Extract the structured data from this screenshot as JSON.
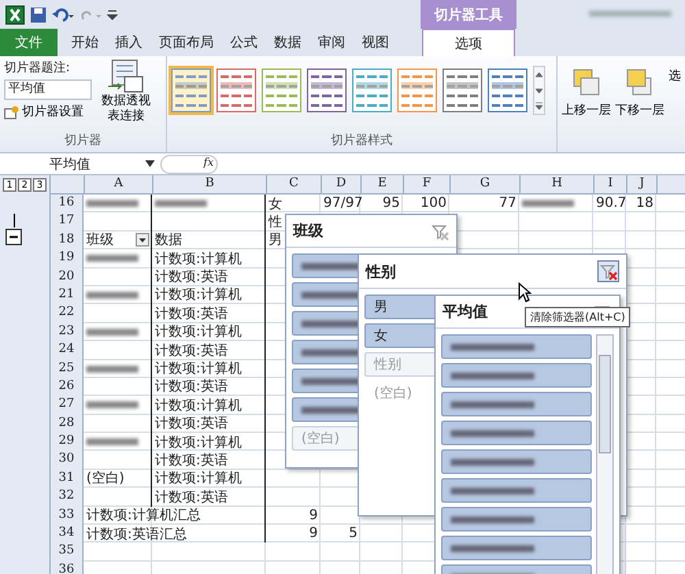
{
  "contextual_tab": {
    "title": "切片器工具"
  },
  "tabs": [
    {
      "label": "文件",
      "kind": "file",
      "selected": false
    },
    {
      "label": "开始",
      "kind": "tab",
      "selected": false
    },
    {
      "label": "插入",
      "kind": "tab",
      "selected": false
    },
    {
      "label": "页面布局",
      "kind": "tab",
      "selected": false
    },
    {
      "label": "公式",
      "kind": "tab",
      "selected": false
    },
    {
      "label": "数据",
      "kind": "tab",
      "selected": false
    },
    {
      "label": "审阅",
      "kind": "tab",
      "selected": false
    },
    {
      "label": "视图",
      "kind": "tab",
      "selected": false
    },
    {
      "label": "选项",
      "kind": "contextual",
      "selected": true
    }
  ],
  "ribbon": {
    "caption_label": "切片器题注:",
    "caption_value": "平均值",
    "settings_button": "切片器设置",
    "connections_button": "数据透视表连接",
    "group_1": "切片器",
    "group_2": "切片器样式",
    "styles": [
      {
        "color": "#7f9cc8",
        "selected": true
      },
      {
        "color": "#d86a6a",
        "selected": false
      },
      {
        "color": "#9bbb59",
        "selected": false
      },
      {
        "color": "#8064a2",
        "selected": false
      },
      {
        "color": "#4bacc6",
        "selected": false
      },
      {
        "color": "#f79646",
        "selected": false
      },
      {
        "color": "#7f7f7f",
        "selected": false
      },
      {
        "color": "#4f81bd",
        "selected": false
      }
    ],
    "arrange_buttons": [
      "上移一层",
      "下移一层",
      "选"
    ]
  },
  "formula_bar": {
    "name_box": "平均值",
    "fx": "fx"
  },
  "outline_levels": [
    "1",
    "2",
    "3"
  ],
  "columns": [
    "A",
    "B",
    "C",
    "D",
    "E",
    "F",
    "G",
    "H",
    "I",
    "J"
  ],
  "rows": [
    {
      "n": "16",
      "cells": [
        {
          "kind": "blurred"
        },
        {
          "kind": "blurred"
        },
        {
          "text": "女"
        },
        {
          "text": "97/97",
          "kind": "number"
        },
        {
          "text": "95",
          "kind": "number"
        },
        {
          "text": "100",
          "kind": "number"
        },
        {
          "text": "77",
          "kind": "number"
        },
        {
          "kind": "blurred"
        },
        {
          "text": "90.7",
          "kind": "number"
        },
        {
          "text": "18",
          "kind": "number"
        }
      ]
    },
    {
      "n": "17",
      "cells": [
        null,
        null,
        {
          "text": "性"
        }
      ]
    },
    {
      "n": "18",
      "cells": [
        {
          "text": "班级",
          "dropdown": true
        },
        {
          "text": "数据"
        },
        {
          "text": "男"
        }
      ]
    },
    {
      "n": "19",
      "cells": [
        {
          "kind": "blurred"
        },
        {
          "text": "计数项:计算机"
        }
      ]
    },
    {
      "n": "20",
      "cells": [
        null,
        {
          "text": "计数项:英语"
        }
      ]
    },
    {
      "n": "21",
      "cells": [
        {
          "kind": "blurred"
        },
        {
          "text": "计数项:计算机"
        }
      ]
    },
    {
      "n": "22",
      "cells": [
        null,
        {
          "text": "计数项:英语"
        }
      ]
    },
    {
      "n": "23",
      "cells": [
        {
          "kind": "blurred"
        },
        {
          "text": "计数项:计算机"
        }
      ]
    },
    {
      "n": "24",
      "cells": [
        null,
        {
          "text": "计数项:英语"
        }
      ]
    },
    {
      "n": "25",
      "cells": [
        {
          "kind": "blurred"
        },
        {
          "text": "计数项:计算机"
        }
      ]
    },
    {
      "n": "26",
      "cells": [
        null,
        {
          "text": "计数项:英语"
        }
      ]
    },
    {
      "n": "27",
      "cells": [
        {
          "kind": "blurred"
        },
        {
          "text": "计数项:计算机"
        }
      ]
    },
    {
      "n": "28",
      "cells": [
        null,
        {
          "text": "计数项:英语"
        }
      ]
    },
    {
      "n": "29",
      "cells": [
        {
          "kind": "blurred"
        },
        {
          "text": "计数项:计算机"
        }
      ]
    },
    {
      "n": "30",
      "cells": [
        null,
        {
          "text": "计数项:英语"
        }
      ]
    },
    {
      "n": "31",
      "cells": [
        {
          "text": "(空白)"
        },
        {
          "text": "计数项:计算机"
        }
      ]
    },
    {
      "n": "32",
      "cells": [
        null,
        {
          "text": "计数项:英语"
        }
      ]
    },
    {
      "n": "33",
      "cells": [
        {
          "text": "计数项:计算机汇总"
        },
        null,
        {
          "text": "9",
          "kind": "number"
        }
      ]
    },
    {
      "n": "34",
      "cells": [
        {
          "text": "计数项:英语汇总"
        },
        null,
        {
          "text": "9",
          "kind": "number"
        },
        {
          "text": "5",
          "kind": "number"
        }
      ]
    },
    {
      "n": "35",
      "cells": []
    },
    {
      "n": "36",
      "cells": []
    }
  ],
  "slicers": [
    {
      "title": "班级",
      "filtered": false,
      "items": [
        {
          "kind": "blurred",
          "selected": true
        },
        {
          "kind": "blurred",
          "selected": true
        },
        {
          "kind": "blurred",
          "selected": true
        },
        {
          "kind": "blurred",
          "selected": true
        },
        {
          "kind": "blurred",
          "selected": true
        },
        {
          "kind": "blurred",
          "selected": true
        },
        {
          "kind": "text",
          "label": "(空白)",
          "selected": false
        }
      ]
    },
    {
      "title": "性别",
      "filtered": true,
      "items": [
        {
          "kind": "text",
          "label": "男",
          "selected": true
        },
        {
          "kind": "text",
          "label": "女",
          "selected": true
        },
        {
          "kind": "text",
          "label": "性别",
          "selected": false
        },
        {
          "kind": "plain",
          "label": "(空白)",
          "selected": false
        }
      ]
    },
    {
      "title": "平均值",
      "filtered": false,
      "scroll": true,
      "items": [
        {
          "kind": "blurred",
          "selected": true
        },
        {
          "kind": "blurred",
          "selected": true
        },
        {
          "kind": "blurred",
          "selected": true
        },
        {
          "kind": "blurred",
          "selected": true
        },
        {
          "kind": "blurred",
          "selected": true
        },
        {
          "kind": "blurred",
          "selected": true
        },
        {
          "kind": "blurred",
          "selected": true
        },
        {
          "kind": "blurred",
          "selected": true
        },
        {
          "kind": "blurred",
          "selected": true
        }
      ]
    }
  ],
  "tooltip": "清除筛选器(Alt+C)"
}
